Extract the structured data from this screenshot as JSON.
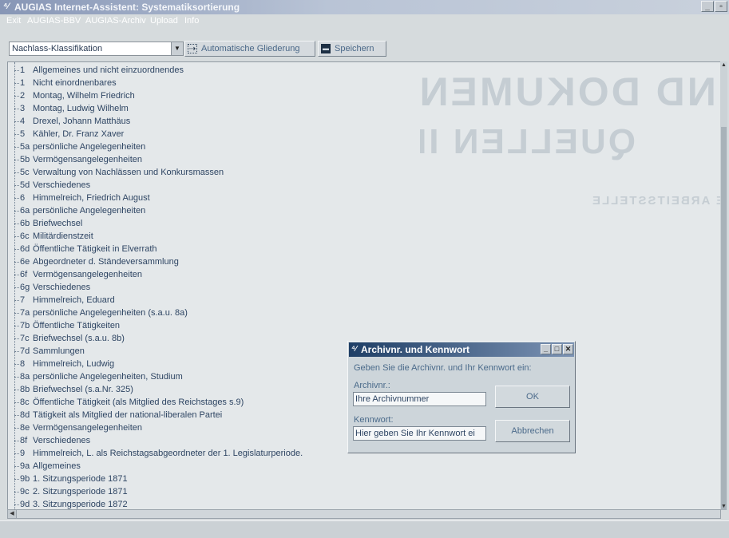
{
  "window": {
    "title": "AUGIAS Internet-Assistent: Systematiksortierung"
  },
  "menu": [
    "Exit",
    "AUGIAS-BBV",
    "AUGIAS-Archiv",
    "Upload",
    "Info"
  ],
  "toolbar": {
    "dropdown_value": "Nachlass-Klassifikation",
    "auto_outline_label": "Automatische Gliederung",
    "save_label": "Speichern"
  },
  "tree": {
    "items": [
      {
        "code": "1",
        "label": "Allgemeines und nicht einzuordnendes"
      },
      {
        "code": "1",
        "label": "Nicht einordnenbares"
      },
      {
        "code": "2",
        "label": "Montag, Wilhelm Friedrich"
      },
      {
        "code": "3",
        "label": "Montag, Ludwig Wilhelm"
      },
      {
        "code": "4",
        "label": "Drexel, Johann Matthäus"
      },
      {
        "code": "5",
        "label": "Kähler, Dr. Franz Xaver"
      },
      {
        "code": "5a",
        "label": "persönliche Angelegenheiten"
      },
      {
        "code": "5b",
        "label": "Vermögensangelegenheiten"
      },
      {
        "code": "5c",
        "label": "Verwaltung von Nachlässen und Konkursmassen"
      },
      {
        "code": "5d",
        "label": "Verschiedenes"
      },
      {
        "code": "6",
        "label": "Himmelreich, Friedrich August"
      },
      {
        "code": "6a",
        "label": "persönliche Angelegenheiten"
      },
      {
        "code": "6b",
        "label": "Briefwechsel"
      },
      {
        "code": "6c",
        "label": "Militärdienstzeit"
      },
      {
        "code": "6d",
        "label": "Öffentliche Tätigkeit in Elverrath"
      },
      {
        "code": "6e",
        "label": "Abgeordneter d. Ständeversammlung"
      },
      {
        "code": "6f",
        "label": "Vermögensangelegenheiten"
      },
      {
        "code": "6g",
        "label": "Verschiedenes"
      },
      {
        "code": "7",
        "label": "Himmelreich, Eduard"
      },
      {
        "code": "7a",
        "label": "persönliche Angelegenheiten (s.a.u. 8a)"
      },
      {
        "code": "7b",
        "label": "Öffentliche Tätigkeiten"
      },
      {
        "code": "7c",
        "label": "Briefwechsel (s.a.u. 8b)"
      },
      {
        "code": "7d",
        "label": "Sammlungen"
      },
      {
        "code": "8",
        "label": "Himmelreich, Ludwig"
      },
      {
        "code": "8a",
        "label": "persönliche Angelegenheiten, Studium"
      },
      {
        "code": "8b",
        "label": "Briefwechsel (s.a.Nr. 325)"
      },
      {
        "code": "8c",
        "label": "Öffentliche Tätigkeit (als Mitglied des Reichstages s.9)"
      },
      {
        "code": "8d",
        "label": "Tätigkeit als Mitglied der national-liberalen Partei"
      },
      {
        "code": "8e",
        "label": "Vermögensangelegenheiten"
      },
      {
        "code": "8f",
        "label": "Verschiedenes"
      },
      {
        "code": "9",
        "label": "Himmelreich, L. als Reichstagsabgeordneter der 1. Legislaturperiode."
      },
      {
        "code": "9a",
        "label": "Allgemeines"
      },
      {
        "code": "9b",
        "label": "1. Sitzungsperiode 1871"
      },
      {
        "code": "9c",
        "label": "2. Sitzungsperiode 1871"
      },
      {
        "code": "9d",
        "label": "3. Sitzungsperiode 1872"
      }
    ]
  },
  "dialog": {
    "title": "Archivnr. und Kennwort",
    "prompt": "Geben Sie die Archivnr. und Ihr Kennwort ein:",
    "archive_label": "Archivnr.:",
    "archive_value": "Ihre Archivnummer",
    "password_label": "Kennwort:",
    "password_value": "Hier geben Sie Ihr Kennwort ei",
    "ok_label": "OK",
    "cancel_label": "Abbrechen"
  },
  "background_watermark": {
    "line1": "UND DOKUMENTATION",
    "line2": "QUELLEN IM LAND",
    "line3": "DIE ARBEITSSTELLE"
  },
  "colors": {
    "titlebar_start": "#8796b6",
    "dialog_title": "#1f3f66",
    "tree_bg": "#e4e8ea",
    "text": "#2e4563"
  }
}
